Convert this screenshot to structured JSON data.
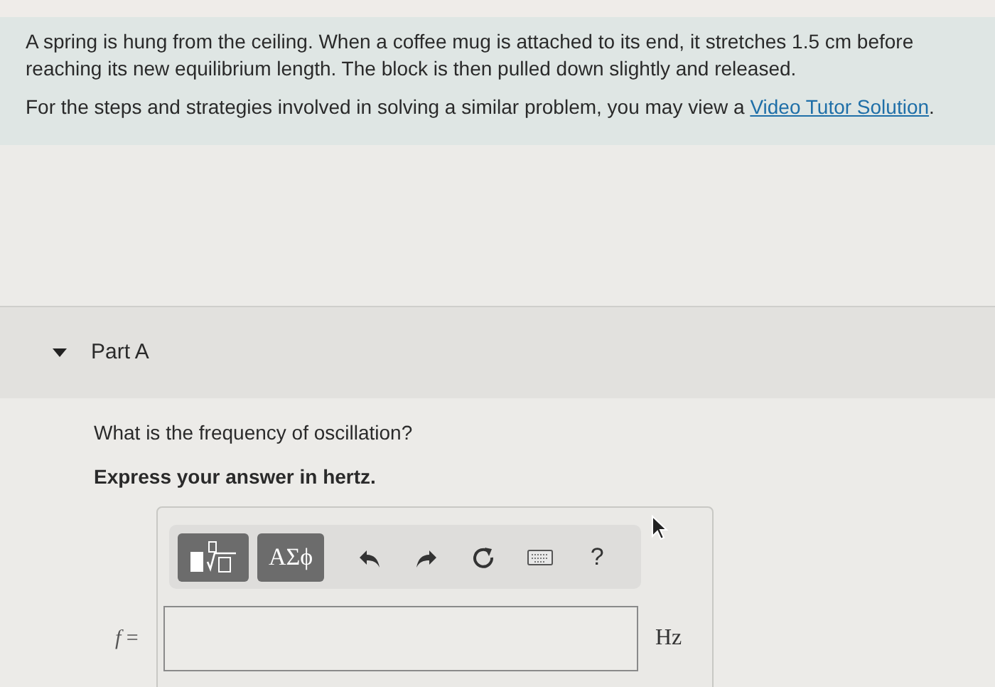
{
  "problem": {
    "text": "A spring is hung from the ceiling. When a coffee mug is attached to its end, it stretches 1.5 cm before reaching its new equilibrium length. The block is then pulled down slightly and released.",
    "hint": "For the steps and strategies involved in solving a similar problem, you may view a ",
    "link": "Video Tutor Solution",
    "hint_end": "."
  },
  "part": {
    "title": "Part A",
    "expanded": true
  },
  "question": "What is the frequency of oscillation?",
  "instruction": "Express your answer in hertz.",
  "toolbar": [
    {
      "kind": "templates"
    },
    {
      "kind": "symbols",
      "label": "ΑΣϕ"
    },
    {
      "kind": "undo"
    },
    {
      "kind": "redo"
    },
    {
      "kind": "reset"
    },
    {
      "kind": "keyboard"
    },
    {
      "kind": "help",
      "label": "?"
    }
  ],
  "answer": {
    "label": "*f* =",
    "unit": "Hz"
  }
}
